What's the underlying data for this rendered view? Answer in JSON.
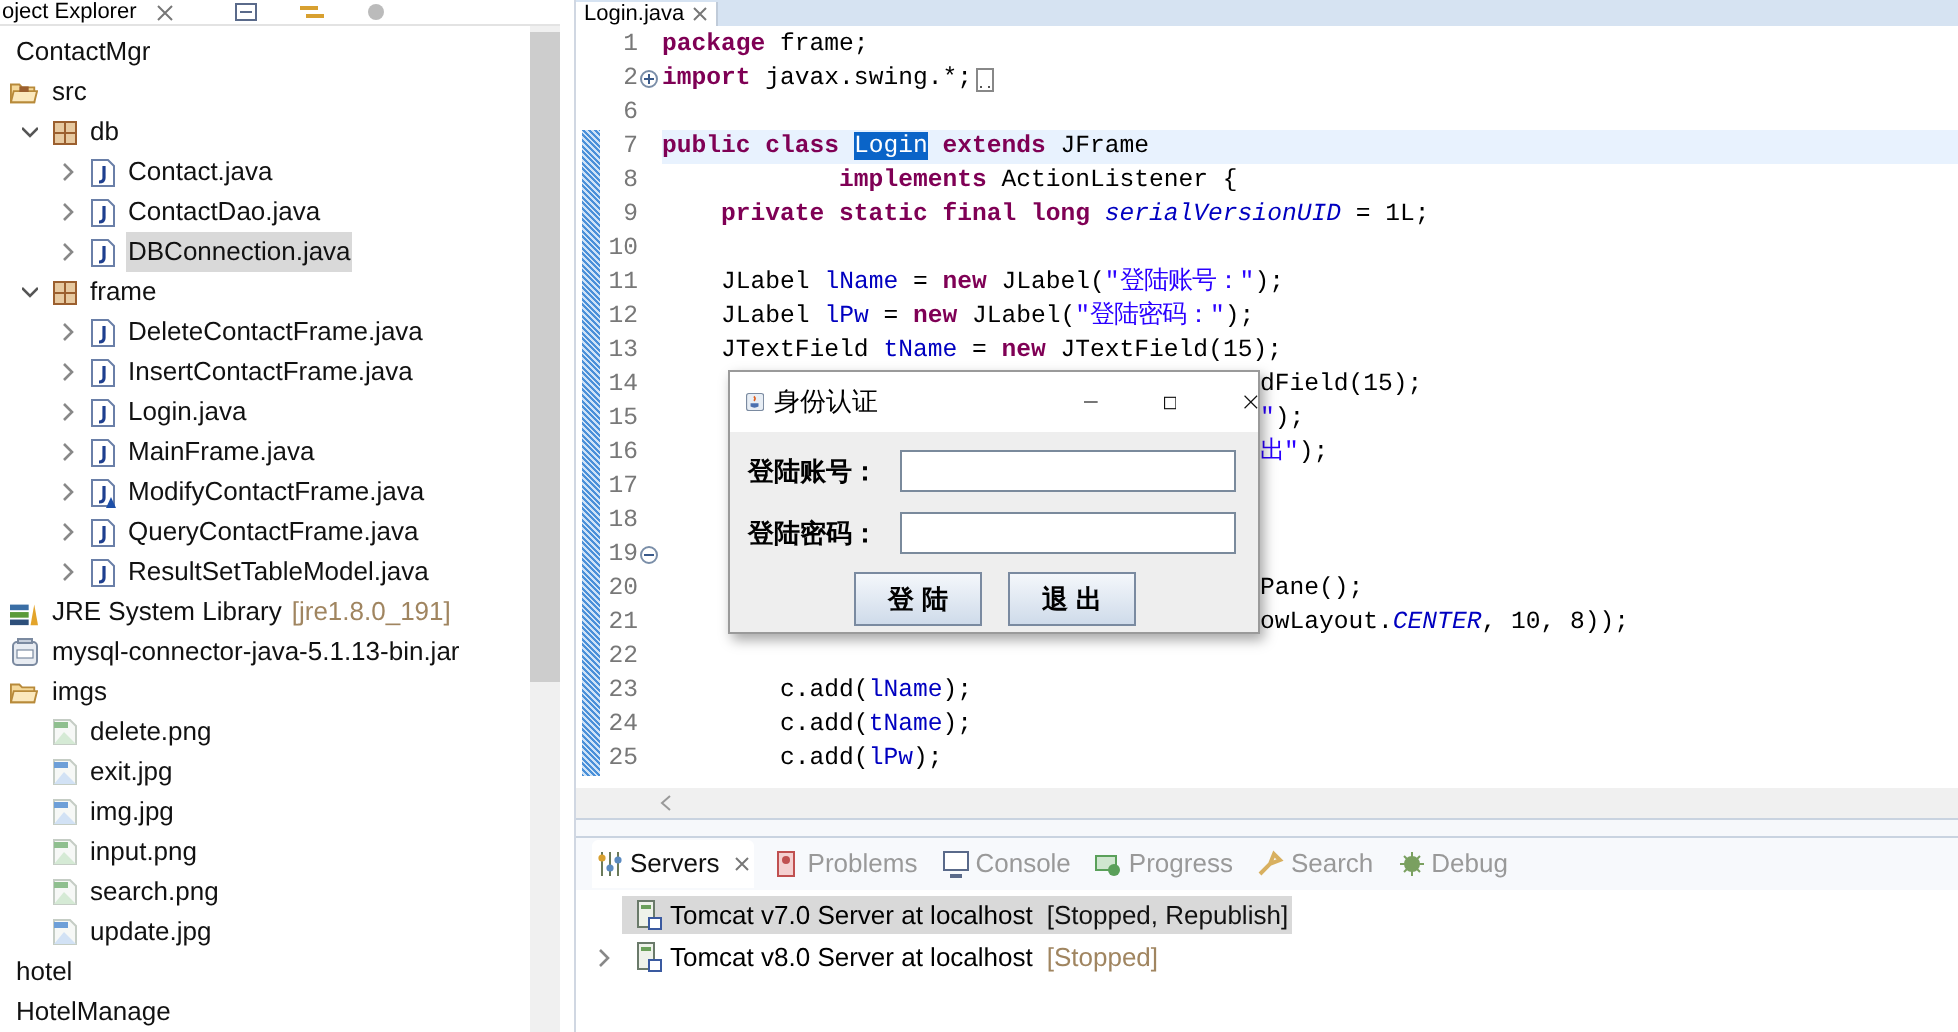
{
  "explorer": {
    "title": "oject Explorer",
    "tree": [
      {
        "label": "ContactMgr",
        "selected": false,
        "children": [
          {
            "label": "src",
            "kind": "source-folder",
            "selected": false,
            "children": [
              {
                "label": "db",
                "kind": "package",
                "expanded": true,
                "selected": false,
                "children": [
                  {
                    "label": "Contact.java",
                    "kind": "java",
                    "expanded": false,
                    "selected": false,
                    "warning": false
                  },
                  {
                    "label": "ContactDao.java",
                    "kind": "java",
                    "expanded": false,
                    "selected": false,
                    "warning": false
                  },
                  {
                    "label": "DBConnection.java",
                    "kind": "java",
                    "expanded": false,
                    "selected": true,
                    "warning": false
                  }
                ]
              },
              {
                "label": "frame",
                "kind": "package",
                "expanded": true,
                "selected": false,
                "children": [
                  {
                    "label": "DeleteContactFrame.java",
                    "kind": "java",
                    "expanded": false,
                    "selected": false,
                    "warning": false
                  },
                  {
                    "label": "InsertContactFrame.java",
                    "kind": "java",
                    "expanded": false,
                    "selected": false,
                    "warning": false
                  },
                  {
                    "label": "Login.java",
                    "kind": "java",
                    "expanded": false,
                    "selected": false,
                    "warning": false
                  },
                  {
                    "label": "MainFrame.java",
                    "kind": "java",
                    "expanded": false,
                    "selected": false,
                    "warning": false
                  },
                  {
                    "label": "ModifyContactFrame.java",
                    "kind": "java",
                    "expanded": false,
                    "selected": false,
                    "warning": true
                  },
                  {
                    "label": "QueryContactFrame.java",
                    "kind": "java",
                    "expanded": false,
                    "selected": false,
                    "warning": false
                  },
                  {
                    "label": "ResultSetTableModel.java",
                    "kind": "java",
                    "expanded": false,
                    "selected": false,
                    "warning": false
                  }
                ]
              }
            ]
          },
          {
            "label": "JRE System Library",
            "decoration": "[jre1.8.0_191]",
            "kind": "library",
            "selected": false
          },
          {
            "label": "mysql-connector-java-5.1.13-bin.jar",
            "kind": "jar",
            "selected": false
          },
          {
            "label": "imgs",
            "kind": "folder",
            "selected": false,
            "children": [
              {
                "label": "delete.png",
                "kind": "png",
                "selected": false
              },
              {
                "label": "exit.jpg",
                "kind": "jpg",
                "selected": false
              },
              {
                "label": "img.jpg",
                "kind": "jpg",
                "selected": false
              },
              {
                "label": "input.png",
                "kind": "png",
                "selected": false
              },
              {
                "label": "search.png",
                "kind": "png",
                "selected": false
              },
              {
                "label": "update.jpg",
                "kind": "jpg",
                "selected": false
              }
            ]
          }
        ]
      },
      {
        "label": "hotel",
        "selected": false
      },
      {
        "label": "HotelManage",
        "selected": false
      }
    ]
  },
  "editor": {
    "tab": "Login.java",
    "lines": [
      {
        "number": "1",
        "changed": false,
        "current": false,
        "segments": [
          {
            "text": "package",
            "kind": "keyword"
          },
          {
            "text": " frame;",
            "kind": "plain"
          }
        ]
      },
      {
        "number": "2",
        "changed": false,
        "current": false,
        "folded": true,
        "segments": [
          {
            "text": "import",
            "kind": "keyword"
          },
          {
            "text": " javax.swing.*;",
            "kind": "plain"
          }
        ]
      },
      {
        "number": "6",
        "changed": false,
        "current": false
      },
      {
        "number": "7",
        "changed": true,
        "current": true,
        "segments": [
          {
            "text": "public class ",
            "kind": "keyword"
          },
          {
            "text": "Login",
            "kind": "selection"
          },
          {
            "text": " extends",
            "kind": "keyword"
          },
          {
            "text": " JFrame",
            "kind": "plain"
          }
        ]
      },
      {
        "number": "8",
        "changed": true,
        "current": false,
        "segments": [
          {
            "text": "            implements",
            "kind": "keyword"
          },
          {
            "text": " ActionListener {",
            "kind": "plain"
          }
        ]
      },
      {
        "number": "9",
        "changed": true,
        "current": false,
        "segments": [
          {
            "text": "    private static final long ",
            "kind": "keyword"
          },
          {
            "text": "serialVersionUID",
            "kind": "static"
          },
          {
            "text": " = 1L;",
            "kind": "plain"
          }
        ]
      },
      {
        "number": "10",
        "changed": true,
        "current": false
      },
      {
        "number": "11",
        "changed": true,
        "current": false,
        "segments": [
          {
            "text": "    JLabel ",
            "kind": "plain"
          },
          {
            "text": "lName",
            "kind": "field"
          },
          {
            "text": " = ",
            "kind": "plain"
          },
          {
            "text": "new",
            "kind": "keyword"
          },
          {
            "text": " JLabel(",
            "kind": "plain"
          },
          {
            "text": "\"登陆账号：\"",
            "kind": "string"
          },
          {
            "text": ");",
            "kind": "plain"
          }
        ]
      },
      {
        "number": "12",
        "changed": true,
        "current": false,
        "segments": [
          {
            "text": "    JLabel ",
            "kind": "plain"
          },
          {
            "text": "lPw",
            "kind": "field"
          },
          {
            "text": " = ",
            "kind": "plain"
          },
          {
            "text": "new",
            "kind": "keyword"
          },
          {
            "text": " JLabel(",
            "kind": "plain"
          },
          {
            "text": "\"登陆密码：\"",
            "kind": "string"
          },
          {
            "text": ");",
            "kind": "plain"
          }
        ]
      },
      {
        "number": "13",
        "changed": true,
        "current": false,
        "segments": [
          {
            "text": "    JTextField ",
            "kind": "plain"
          },
          {
            "text": "tName",
            "kind": "field"
          },
          {
            "text": " = ",
            "kind": "plain"
          },
          {
            "text": "new",
            "kind": "keyword"
          },
          {
            "text": " JTextField(15);",
            "kind": "plain"
          }
        ]
      },
      {
        "number": "14",
        "changed": true,
        "current": false,
        "covered": true,
        "segments": [
          {
            "text": "dField(15);",
            "kind": "plain"
          }
        ]
      },
      {
        "number": "15",
        "changed": true,
        "current": false,
        "covered": true,
        "segments": [
          {
            "text": "\"",
            "kind": "string"
          },
          {
            "text": ");",
            "kind": "plain"
          }
        ]
      },
      {
        "number": "16",
        "changed": true,
        "current": false,
        "covered": true,
        "segments": [
          {
            "text": "出\"",
            "kind": "string"
          },
          {
            "text": ");",
            "kind": "plain"
          }
        ]
      },
      {
        "number": "17",
        "changed": true,
        "current": false,
        "covered": true
      },
      {
        "number": "18",
        "changed": true,
        "current": false,
        "covered": true
      },
      {
        "number": "19",
        "changed": true,
        "current": false,
        "covered": true,
        "folded": false
      },
      {
        "number": "20",
        "changed": true,
        "current": false,
        "covered": true,
        "segments": [
          {
            "text": "Pane();",
            "kind": "plain"
          }
        ]
      },
      {
        "number": "21",
        "changed": true,
        "current": false,
        "covered": true,
        "segments": [
          {
            "text": "owLayout.",
            "kind": "plain"
          },
          {
            "text": "CENTER",
            "kind": "static"
          },
          {
            "text": ", 10, 8));",
            "kind": "plain"
          }
        ]
      },
      {
        "number": "22",
        "changed": true,
        "current": false
      },
      {
        "number": "23",
        "changed": true,
        "current": false,
        "segments": [
          {
            "text": "        c.add(",
            "kind": "plain"
          },
          {
            "text": "lName",
            "kind": "field"
          },
          {
            "text": ");",
            "kind": "plain"
          }
        ]
      },
      {
        "number": "24",
        "changed": true,
        "current": false,
        "segments": [
          {
            "text": "        c.add(",
            "kind": "plain"
          },
          {
            "text": "tName",
            "kind": "field"
          },
          {
            "text": ");",
            "kind": "plain"
          }
        ]
      },
      {
        "number": "25",
        "changed": true,
        "current": false,
        "segments": [
          {
            "text": "        c.add(",
            "kind": "plain"
          },
          {
            "text": "lPw",
            "kind": "field"
          },
          {
            "text": ");",
            "kind": "plain"
          }
        ]
      }
    ]
  },
  "dialog": {
    "title": "身份认证",
    "fields": [
      {
        "label": "登陆账号："
      },
      {
        "label": "登陆密码："
      }
    ],
    "buttons": [
      "登 陆",
      "退 出"
    ]
  },
  "bottom_panel": {
    "tabs": [
      {
        "label": "Servers",
        "kind": "servers",
        "selected": true
      },
      {
        "label": "Problems",
        "kind": "problems",
        "selected": false
      },
      {
        "label": "Console",
        "kind": "console",
        "selected": false
      },
      {
        "label": "Progress",
        "kind": "progress",
        "selected": false
      },
      {
        "label": "Search",
        "kind": "search",
        "selected": false
      },
      {
        "label": "Debug",
        "kind": "debug",
        "selected": false
      }
    ],
    "servers": [
      {
        "name": "Tomcat v7.0 Server at localhost",
        "status": "[Stopped, Republish]",
        "selected": true
      },
      {
        "name": "Tomcat v8.0 Server at localhost",
        "status": "[Stopped]",
        "selected": false,
        "expanded": false
      }
    ]
  }
}
